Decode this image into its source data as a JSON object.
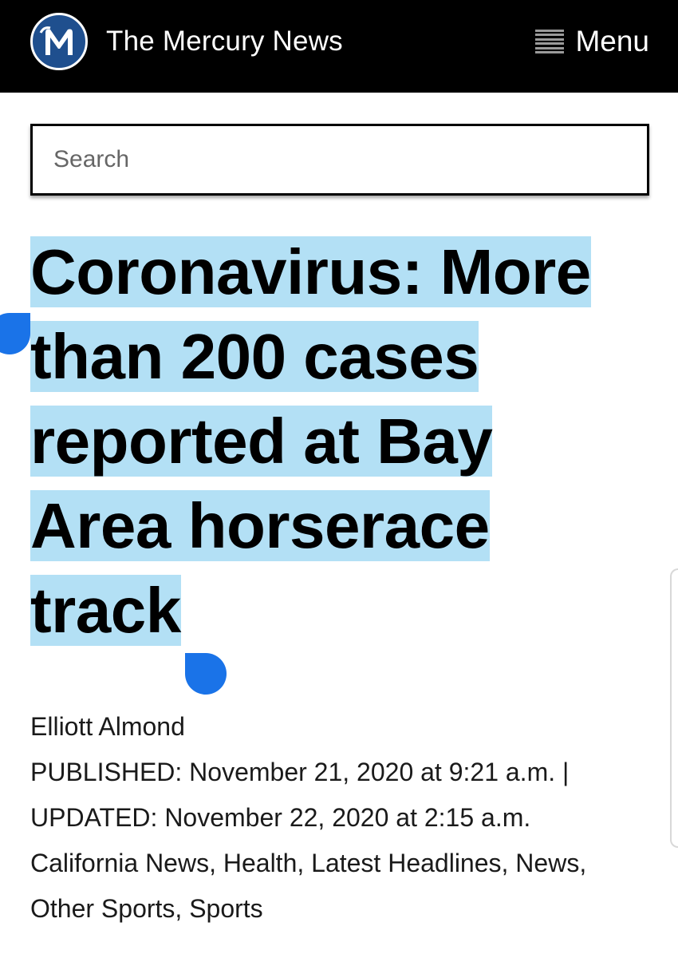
{
  "header": {
    "site_title": "The Mercury News",
    "logo_icon": "mercury-news-m-logo",
    "menu_icon": "hamburger-menu-icon",
    "menu_label": "Menu",
    "background": "#000000"
  },
  "search": {
    "placeholder": "Search",
    "value": ""
  },
  "article": {
    "headline": "Coronavirus: More than 200 cases reported at Bay Area horserace track",
    "headline_selected": true,
    "selection_color": "#b3e0f5",
    "selection_handle_color": "#1a73e8",
    "author": "Elliott Almond",
    "published": "PUBLISHED: November 21, 2020 at 9:21 a.m. |",
    "updated": "UPDATED: November 22, 2020 at 2:15 a.m.",
    "categories_line1": "California News, Health, Latest Headlines, News,",
    "categories_line2": "Other Sports, Sports"
  }
}
